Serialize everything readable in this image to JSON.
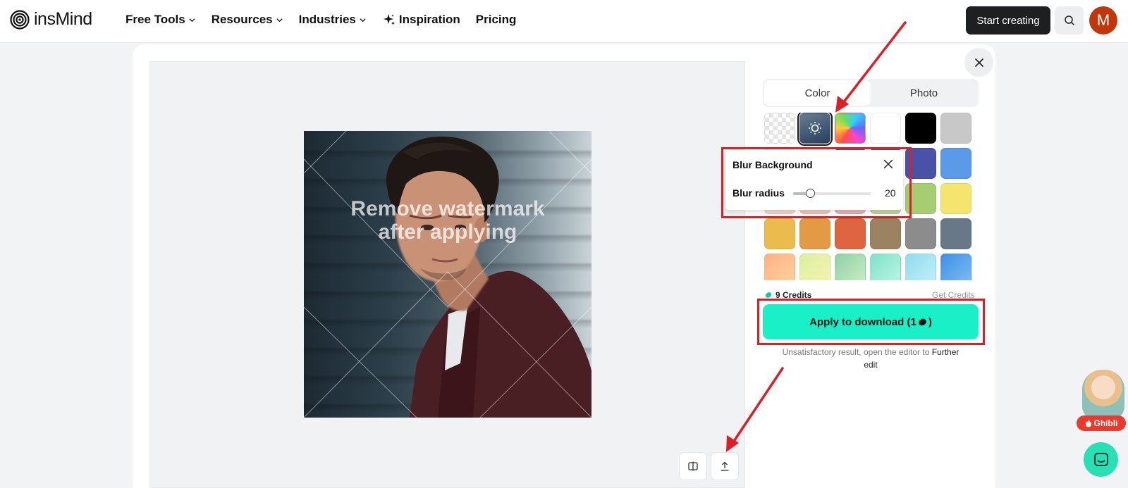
{
  "header": {
    "logo_text": "insMind",
    "nav": [
      {
        "label": "Free Tools",
        "dropdown": true
      },
      {
        "label": "Resources",
        "dropdown": true
      },
      {
        "label": "Industries",
        "dropdown": true
      },
      {
        "label": "Inspiration",
        "icon": "sparkle-icon"
      },
      {
        "label": "Pricing"
      }
    ],
    "start_label": "Start creating",
    "avatar_initial": "M"
  },
  "canvas": {
    "watermark_line1": "Remove watermark",
    "watermark_line2": "after applying"
  },
  "panel": {
    "tabs": [
      {
        "label": "Color",
        "active": true
      },
      {
        "label": "Photo",
        "active": false
      }
    ],
    "swatches": [
      {
        "type": "transparent"
      },
      {
        "type": "blur",
        "selected": true
      },
      {
        "type": "rainbow"
      },
      {
        "type": "color",
        "color": "#ffffff"
      },
      {
        "type": "color",
        "color": "#000000"
      },
      {
        "type": "color",
        "color": "#c8c8c8"
      },
      {
        "type": "color",
        "color": "#e8edf3"
      },
      {
        "type": "color",
        "color": "#d8e0ea"
      },
      {
        "type": "color",
        "color": "#3f51b5"
      },
      {
        "type": "color",
        "color": "#3f4fa8"
      },
      {
        "type": "color",
        "color": "#4a52a8"
      },
      {
        "type": "color",
        "color": "#5b9ae8"
      },
      {
        "type": "color",
        "color": "#f2d7c8"
      },
      {
        "type": "color",
        "color": "#f0c6bd"
      },
      {
        "type": "color",
        "color": "#e6b4b4"
      },
      {
        "type": "color",
        "color": "#c0d6a0"
      },
      {
        "type": "color",
        "color": "#a7cd73"
      },
      {
        "type": "color",
        "color": "#f5e56e"
      },
      {
        "type": "color",
        "color": "#ebbc4d"
      },
      {
        "type": "color",
        "color": "#e39a45"
      },
      {
        "type": "color",
        "color": "#df6440"
      },
      {
        "type": "color",
        "color": "#9b8260"
      },
      {
        "type": "color",
        "color": "#8c8c8c"
      },
      {
        "type": "color",
        "color": "#687886"
      },
      {
        "type": "gradient",
        "color": "#ffb083",
        "color2": "#ffd2a0"
      },
      {
        "type": "gradient",
        "color": "#d9f0a0",
        "color2": "#f6f3b0"
      },
      {
        "type": "gradient",
        "color": "#8fcfa8",
        "color2": "#c9eec2"
      },
      {
        "type": "gradient",
        "color": "#7ee3c9",
        "color2": "#bdf3e4"
      },
      {
        "type": "gradient",
        "color": "#8fdcef",
        "color2": "#c4eff9"
      },
      {
        "type": "gradient",
        "color": "#3d8fe8",
        "color2": "#7fbcf2"
      }
    ],
    "credits": "9 Credits",
    "get_credits": "Get Credits",
    "apply_label": "Apply to download (1",
    "apply_suffix": ")",
    "hint_text": "Unsatisfactory result, open the editor to",
    "hint_link_1": "Further",
    "hint_link_2": "edit"
  },
  "popover": {
    "title": "Blur Background",
    "slider_label": "Blur radius",
    "value": "20",
    "fraction": 0.22
  },
  "floating": {
    "ghibli_label": "Ghibli"
  },
  "colors": {
    "accent": "#19f0c8",
    "highlight": "#dc1f26",
    "avatar": "#c1370b"
  }
}
